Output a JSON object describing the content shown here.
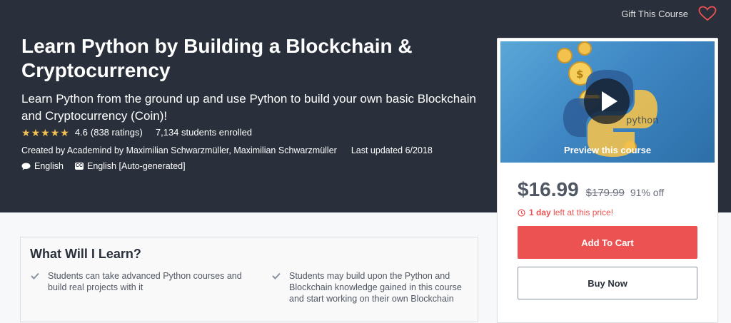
{
  "header": {
    "gift_label": "Gift This Course",
    "wishlist_icon": "heart-icon"
  },
  "course": {
    "title": "Learn Python by Building a Blockchain & Cryptocurrency",
    "subtitle": "Learn Python from the ground up and use Python to build your own basic Blockchain and Cryptocurrency (Coin)!",
    "rating_value": "4.6",
    "rating_count": "(838 ratings)",
    "stars": 5,
    "students": "7,134 students enrolled",
    "created_by": "Created by Academind by Maximilian Schwarzmüller, Maximilian Schwarzmüller",
    "last_updated": "Last updated 6/2018",
    "language": "English",
    "captions": "English [Auto-generated]",
    "star_color": "#f4c150"
  },
  "sidebar": {
    "preview_label": "Preview this course",
    "price": "$16.99",
    "original_price": "$179.99",
    "discount": "91% off",
    "timer_bold": "1 day",
    "timer_rest": "left at this price!",
    "add_to_cart": "Add To Cart",
    "buy_now": "Buy Now",
    "accent_color": "#ec5252"
  },
  "learn": {
    "title": "What Will I Learn?",
    "items": [
      "Students can take advanced Python courses and build real projects with it",
      "Students may build upon the Python and Blockchain knowledge gained in this course and start working on their own Blockchain"
    ]
  }
}
